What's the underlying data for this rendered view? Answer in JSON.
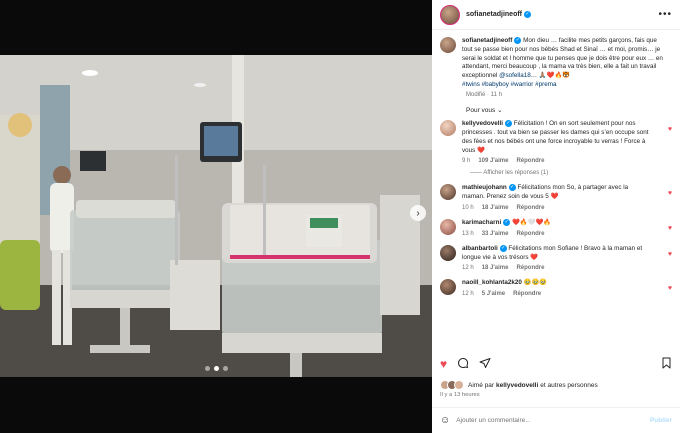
{
  "post": {
    "author": "sofianetadjineoff",
    "caption_rest": " Mon dieu … facilite mes petits garçons, fais que tout se passe bien pour nos bébés Shad et Sinaï … et moi, promis… je serai le soldat et l homme que tu penses que je dois être pour eux … en attendant, merci beaucoup , la mama va très bien, elle a fait un travail exceptionnel ",
    "mention": "@sofella18",
    "caption_emojis": "… 🙏🏽❤️🔥🐯",
    "hashtags": "#twins #babyboy #warrior #prema",
    "edited_label": "Modifié · 11 h"
  },
  "sort_label": "Pour vous",
  "comments": [
    {
      "user": "kellyvedovelli",
      "text": " Félicitation ! On en sort seulement pour nos princesses . tout va bien se passer les dames qui s’en occupe sont des fées et nos bébés ont une force incroyable tu verras ! Force à vous ❤️",
      "time": "9 h",
      "likes": "109 J'aime",
      "reply": "Répondre",
      "heart": "red",
      "has_replies": true,
      "replies_label": "Afficher les réponses (1)"
    },
    {
      "user": "mathieujohann",
      "text": " Félicitations mon So, à partager avec la maman. Prenez soin de vous 5 ❤️",
      "time": "10 h",
      "likes": "18 J'aime",
      "reply": "Répondre",
      "heart": "red"
    },
    {
      "user": "karimacharni",
      "text": " ❤️🔥🤍❤️🔥",
      "time": "13 h",
      "likes": "33 J'aime",
      "reply": "Répondre",
      "heart": "red"
    },
    {
      "user": "albanbartoli",
      "text": " Félicitations mon Sofiane ! Bravo à la maman et longue vie à vos trésors ❤️",
      "time": "12 h",
      "likes": "18 J'aime",
      "reply": "Répondre",
      "heart": "red"
    },
    {
      "user": "naoill_kohlanta2k20",
      "text": " 🥹🥹🥹",
      "time": "12 h",
      "likes": "5 J'aime",
      "reply": "Répondre",
      "heart": "red"
    }
  ],
  "liked_by": {
    "prefix": "Aimé par ",
    "user": "kellyvedovelli",
    "suffix": " et autres personnes"
  },
  "ago": "Il y a 13 heures",
  "composer": {
    "placeholder": "Ajouter un commentaire...",
    "publish": "Publier"
  },
  "colors": {
    "like_red": "#ed4956",
    "verified_blue": "#0095f6",
    "link_blue": "#00376b"
  }
}
